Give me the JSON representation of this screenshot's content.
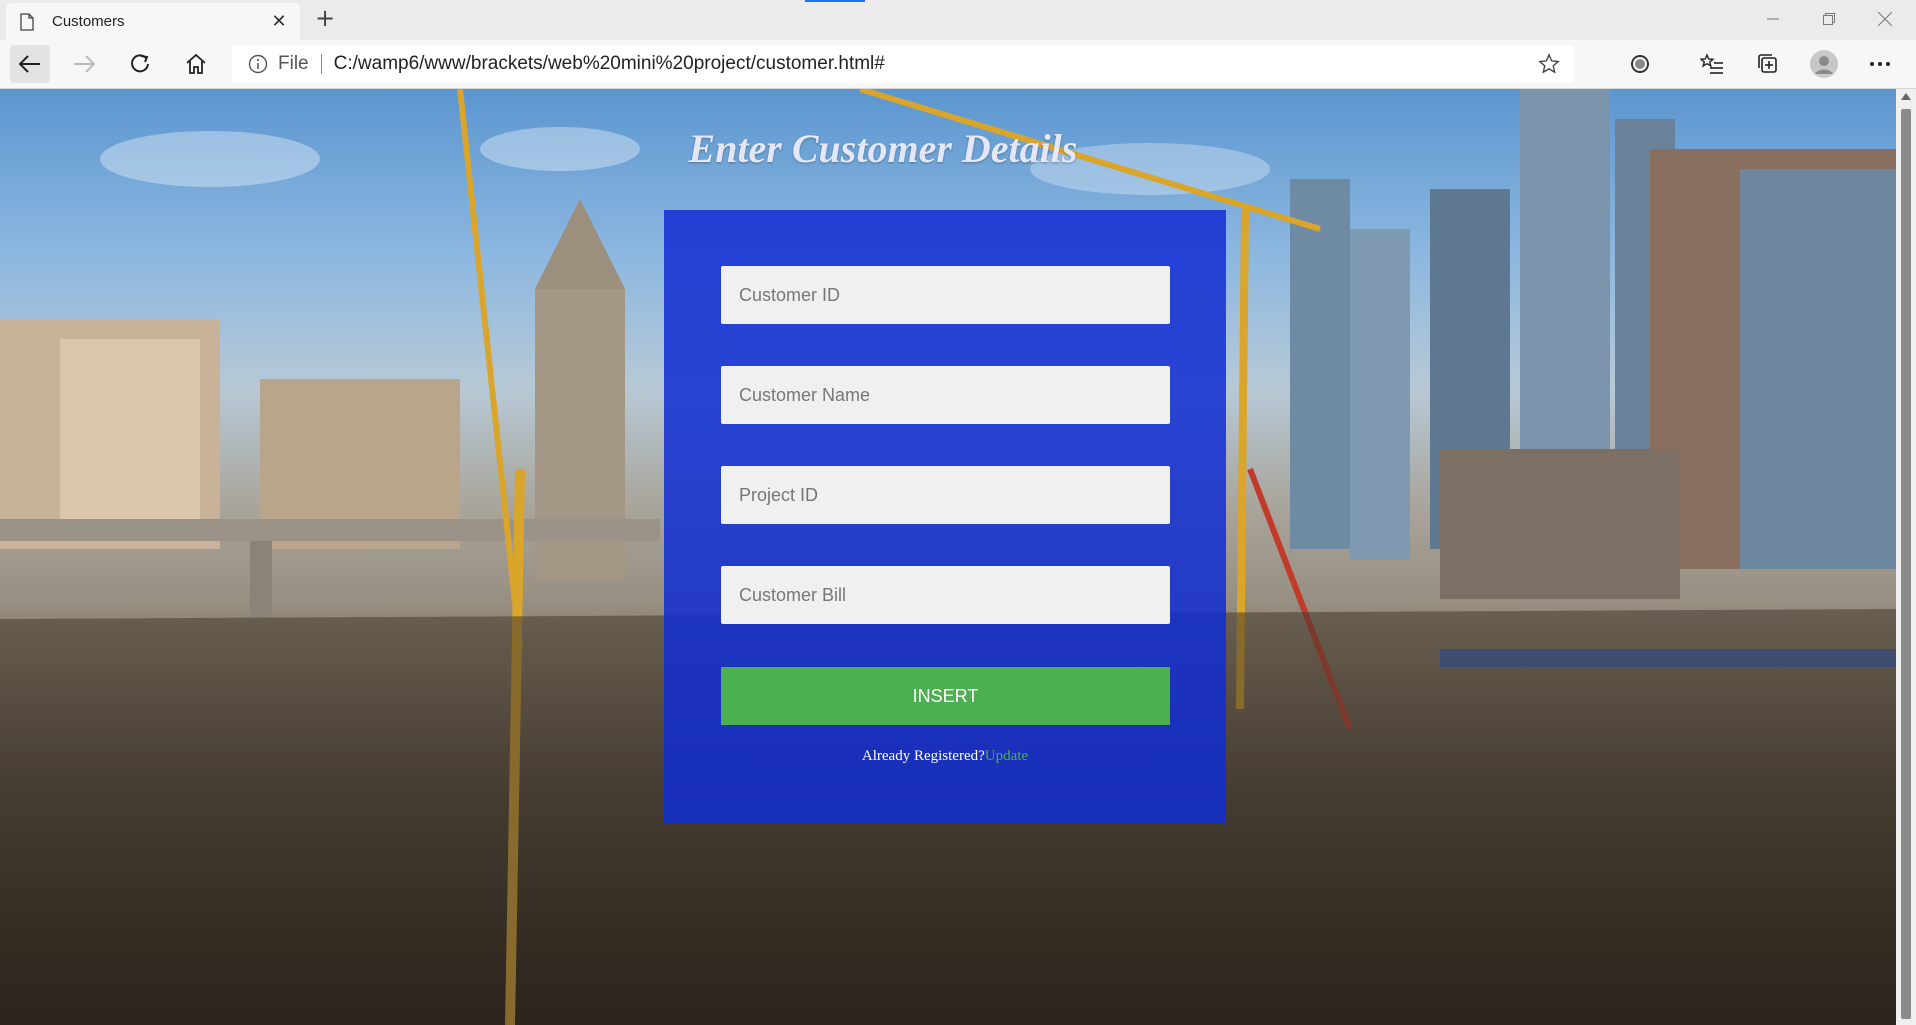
{
  "browser": {
    "tab_title": "Customers",
    "tab_close": "✕",
    "new_tab": "+",
    "address_prefix": "File",
    "url": "C:/wamp6/www/brackets/web%20mini%20project/customer.html#"
  },
  "page": {
    "heading": "Enter Customer Details",
    "fields": [
      {
        "placeholder": "Customer ID",
        "value": ""
      },
      {
        "placeholder": "Customer Name",
        "value": ""
      },
      {
        "placeholder": "Project ID",
        "value": ""
      },
      {
        "placeholder": "Customer Bill",
        "value": ""
      }
    ],
    "insert_label": "INSERT",
    "registered_text": "Already Registered?",
    "update_link": "Update"
  },
  "colors": {
    "panel": "#122dd2",
    "button": "#4caf50",
    "link": "#4caf50"
  }
}
